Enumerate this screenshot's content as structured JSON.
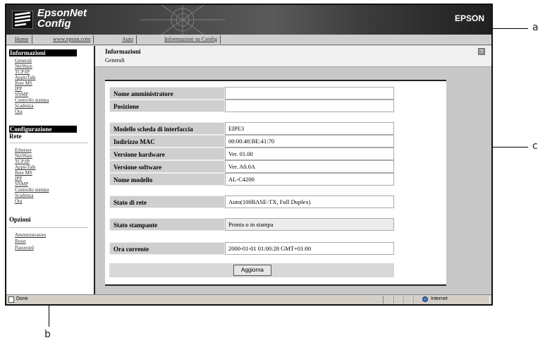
{
  "app": {
    "logo_line1": "EpsonNet",
    "logo_line2": "Config",
    "brand": "EPSON"
  },
  "navbar": {
    "links": [
      "Home",
      "www.epson.com",
      "Auto",
      "Informazioni su Config"
    ]
  },
  "sidebar": {
    "informazioni": {
      "heading": "Informazioni",
      "items": [
        "Generali",
        "NetWare",
        "TCP/IP",
        "AppleTalk",
        "Rete MS",
        "IPP",
        "SNMP",
        "Controllo stampa",
        "Scadenza",
        "Ora"
      ]
    },
    "configurazione": {
      "heading": "Configurazione",
      "subheading": "Rete",
      "items": [
        "Ethernet",
        "NetWare",
        "TCP/IP",
        "AppleTalk",
        "Rete MS",
        "IPP",
        "SNMP",
        "Controllo stampa",
        "Scadenza",
        "Ora"
      ]
    },
    "opzioni": {
      "heading": "Opzioni",
      "items": [
        "Amministratore",
        "Reset",
        "Password"
      ]
    }
  },
  "main": {
    "title": "Informazioni",
    "subtitle": "Generali",
    "help_icon": "question-mark-icon",
    "fields": {
      "admin_name": {
        "label": "Nome amministratore",
        "value": ""
      },
      "location": {
        "label": "Posizione",
        "value": ""
      },
      "interface_model": {
        "label": "Modello scheda di interfaccia",
        "value": "EIPE3"
      },
      "mac_address": {
        "label": "Indirizzo MAC",
        "value": "00:00:48:BE:41:70"
      },
      "hardware_version": {
        "label": "Versione hardware",
        "value": "Ver. 01.00"
      },
      "software_version": {
        "label": "Versione software",
        "value": "Ver. A0.0A"
      },
      "model_name": {
        "label": "Nome modello",
        "value": "AL-C4200"
      },
      "network_status": {
        "label": "Stato di rete",
        "value": "Auto(100BASE-TX, Full Duplex)"
      },
      "printer_status": {
        "label": "Stato stampante",
        "value": "Pronta o in stampa"
      },
      "current_time": {
        "label": "Ora corrente",
        "value": "2000-01-01 01:00:28 GMT+01:00"
      }
    },
    "refresh_button": "Aggiorna"
  },
  "statusbar": {
    "status": "Done",
    "zone": "Internet"
  },
  "callouts": {
    "a": "a",
    "b": "b",
    "c": "c"
  }
}
